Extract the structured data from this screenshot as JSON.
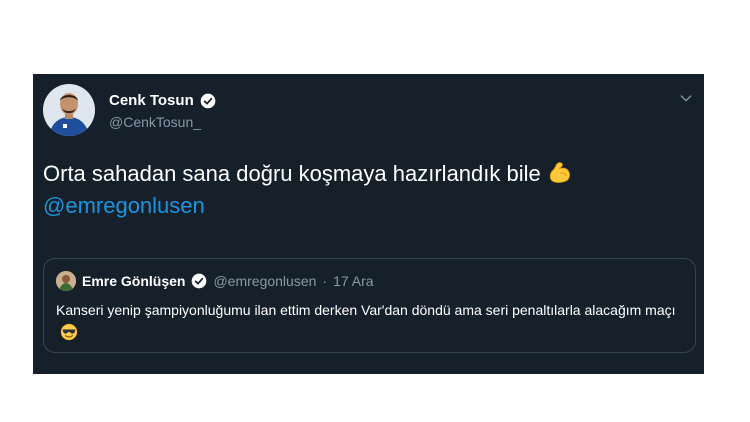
{
  "tweet": {
    "author_name": "Cenk Tosun",
    "author_handle": "@CenkTosun_",
    "text": "Orta sahadan sana doğru koşmaya hazırlandık bile",
    "mention": "@emregonlusen",
    "emoji": "flexed-biceps"
  },
  "quoted_tweet": {
    "author_name": "Emre Gönlüşen",
    "author_handle": "@emregonlusen",
    "separator": "·",
    "date": "17 Ara",
    "text": "Kanseri yenip şampiyonluğumu ilan ettim derken Var'dan döndü ama seri penaltılarla alacağım maçı",
    "emoji": "smiling-face-with-sunglasses"
  },
  "colors": {
    "card_background": "#15202b",
    "text_primary": "#ffffff",
    "text_secondary": "#8899a6",
    "accent": "#1b95e0",
    "border": "#38444d"
  }
}
